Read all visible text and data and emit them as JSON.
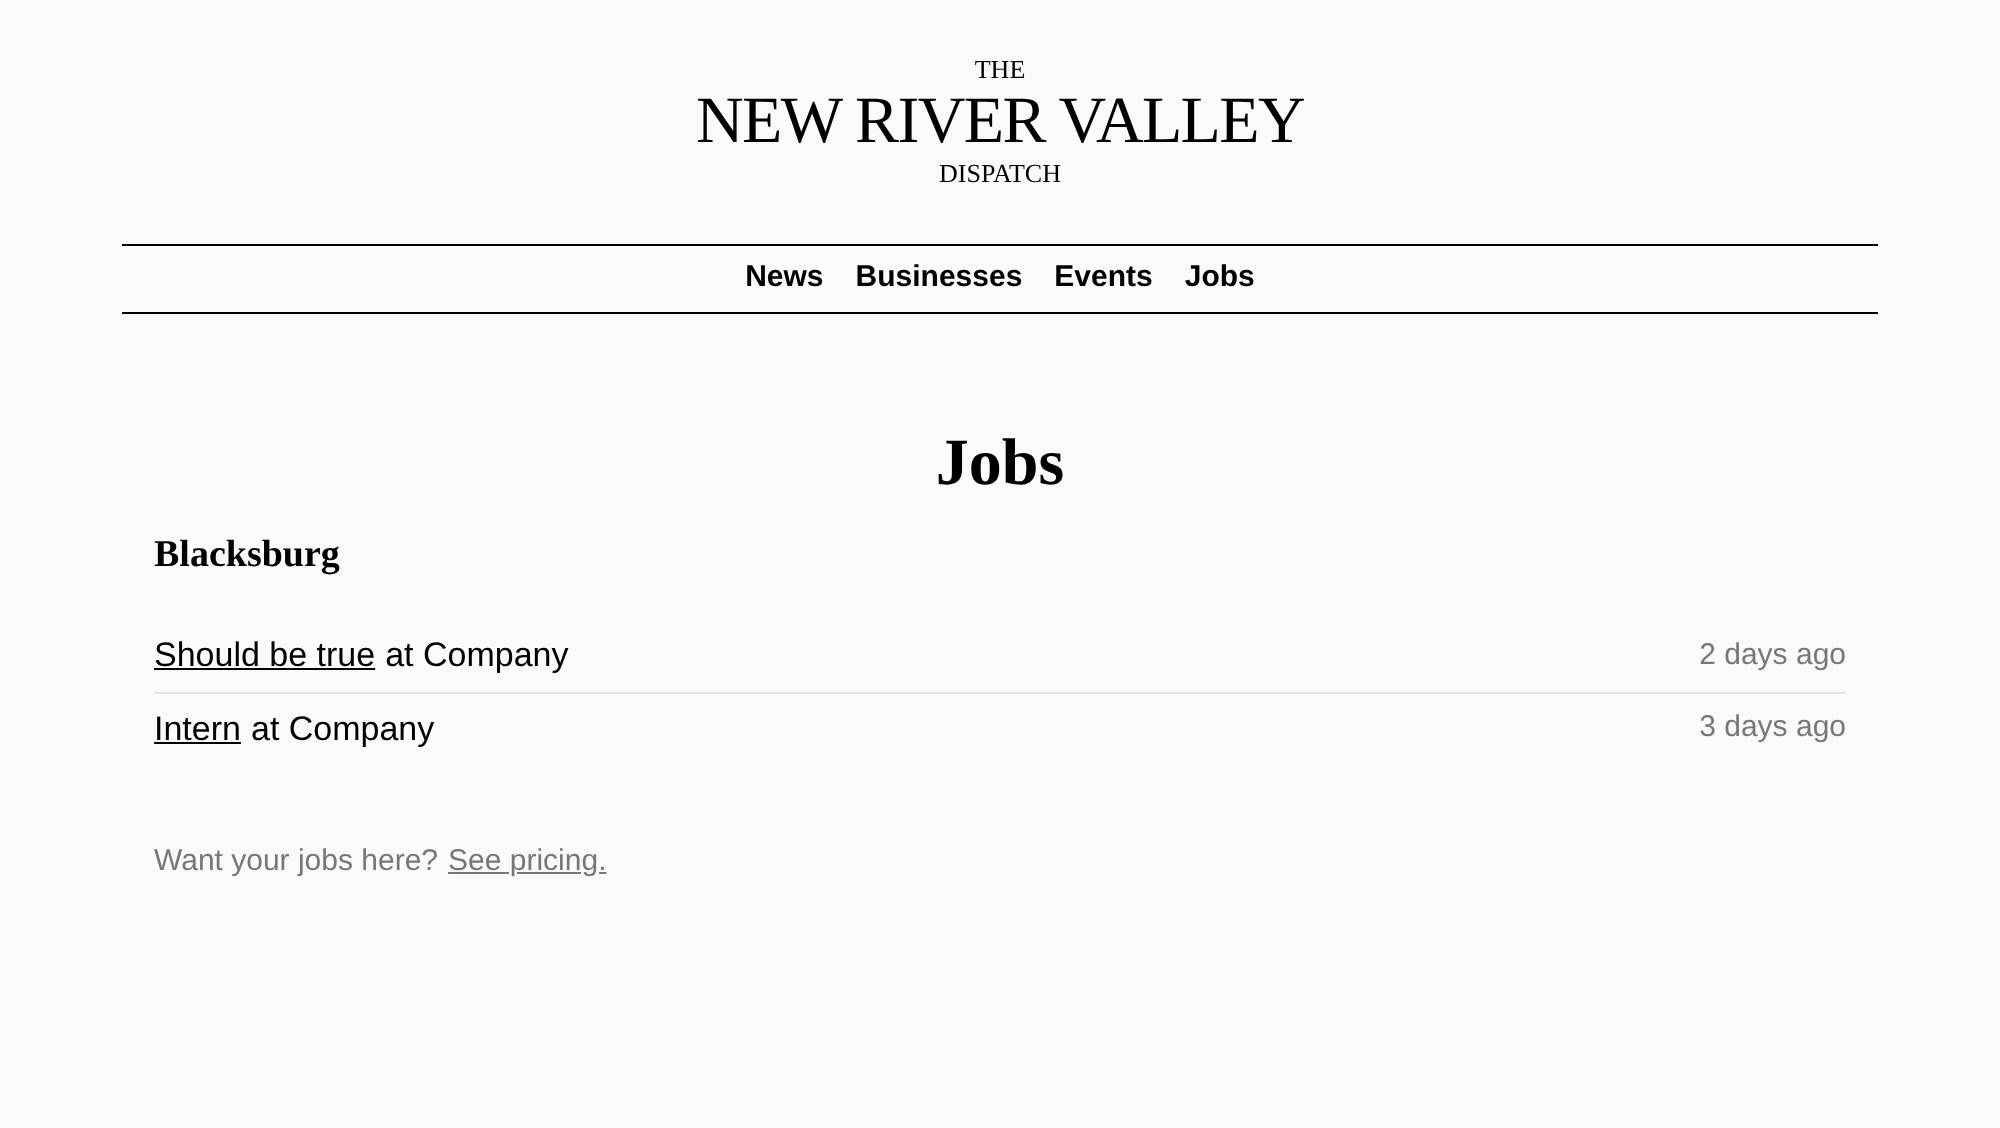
{
  "masthead": {
    "top": "THE",
    "title": "NEW RIVER VALLEY",
    "bottom": "DISPATCH"
  },
  "nav": [
    {
      "label": "News"
    },
    {
      "label": "Businesses"
    },
    {
      "label": "Events"
    },
    {
      "label": "Jobs"
    }
  ],
  "heading": "Jobs",
  "groups": [
    {
      "name": "Blacksburg",
      "jobs": [
        {
          "title": "Should be true",
          "suffix": "at Company",
          "posted": "2 days ago"
        },
        {
          "title": "Intern",
          "suffix": "at Company",
          "posted": "3 days ago"
        }
      ]
    }
  ],
  "footer": {
    "text": "Want your jobs here?",
    "link": "See pricing."
  }
}
